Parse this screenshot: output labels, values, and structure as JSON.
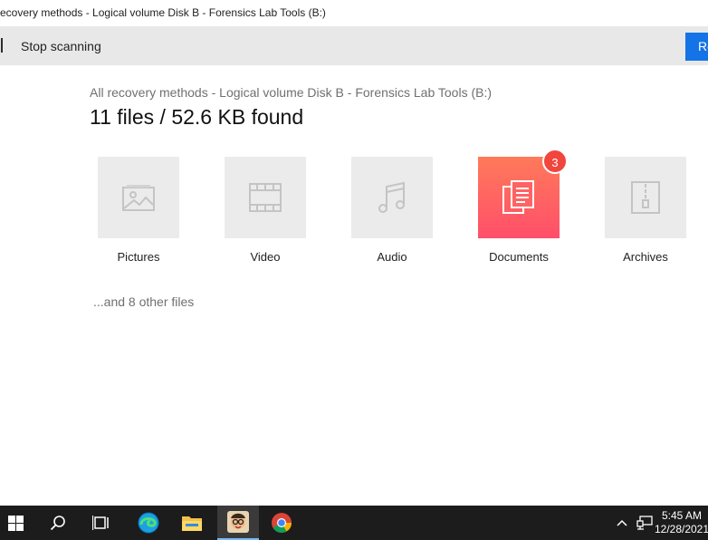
{
  "window": {
    "title": "ecovery methods - Logical volume Disk B - Forensics Lab Tools (B:)"
  },
  "toolbar": {
    "stop_label": "Stop scanning",
    "recover_label": "Re"
  },
  "main": {
    "breadcrumb": "All recovery methods - Logical volume Disk B - Forensics Lab Tools (B:)",
    "summary": "11 files / 52.6 KB found",
    "categories": [
      {
        "label": "Pictures",
        "icon": "picture-icon"
      },
      {
        "label": "Video",
        "icon": "film-icon"
      },
      {
        "label": "Audio",
        "icon": "music-note-icon"
      },
      {
        "label": "Documents",
        "icon": "documents-icon",
        "badge": "3",
        "selected": true
      },
      {
        "label": "Archives",
        "icon": "archive-zip-icon"
      }
    ],
    "other_files": "...and 8 other files"
  },
  "taskbar": {
    "time": "5:45 AM",
    "date": "12/28/2021",
    "apps": [
      "windows-start-icon",
      "search-icon",
      "task-view-icon",
      "edge-icon",
      "file-explorer-icon",
      "app-avatar-icon",
      "chrome-icon"
    ]
  },
  "colors": {
    "accent": "#1473e6",
    "documents_gradient_top": "#ff7a5a",
    "documents_gradient_bottom": "#ff4f6a",
    "badge": "#f0463e",
    "taskbar": "#1c1c1c"
  }
}
